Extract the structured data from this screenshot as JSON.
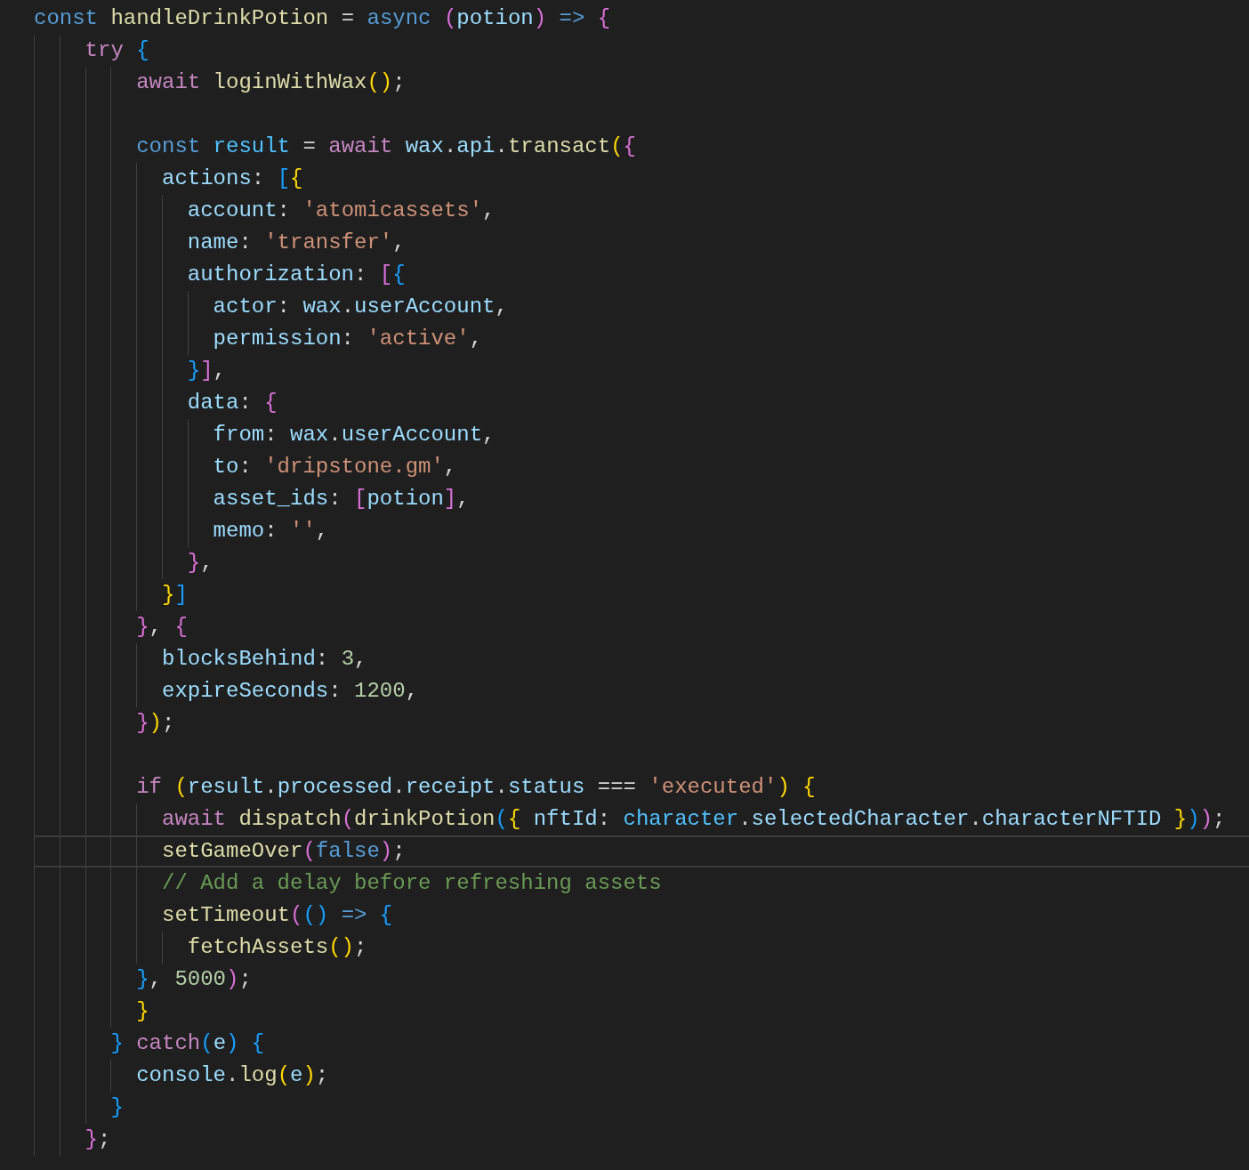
{
  "editor": {
    "lines": [
      {
        "current": false,
        "tokens": [
          {
            "text": "const ",
            "kind": "kw"
          },
          {
            "text": "handleDrinkPotion",
            "kind": "fn"
          },
          {
            "text": " = ",
            "kind": "p"
          },
          {
            "text": "async ",
            "kind": "kw"
          },
          {
            "text": "(",
            "kind": "b2"
          },
          {
            "text": "potion",
            "kind": "var"
          },
          {
            "text": ") ",
            "kind": "b2"
          },
          {
            "text": "=> ",
            "kind": "kw"
          },
          {
            "text": "{",
            "kind": "b2"
          }
        ]
      },
      {
        "current": false,
        "tokens": [
          {
            "text": "    try ",
            "kind": "ctl"
          },
          {
            "text": "{",
            "kind": "b3"
          }
        ]
      },
      {
        "current": false,
        "tokens": [
          {
            "text": "        await ",
            "kind": "ctl"
          },
          {
            "text": "loginWithWax",
            "kind": "fn"
          },
          {
            "text": "()",
            "kind": "b1"
          },
          {
            "text": ";",
            "kind": "p"
          }
        ]
      },
      {
        "current": false
      },
      {
        "current": false,
        "tokens": [
          {
            "text": "        const ",
            "kind": "kw"
          },
          {
            "text": "result",
            "kind": "const"
          },
          {
            "text": " = ",
            "kind": "p"
          },
          {
            "text": "await ",
            "kind": "ctl"
          },
          {
            "text": "wax",
            "kind": "var"
          },
          {
            "text": ".",
            "kind": "p"
          },
          {
            "text": "api",
            "kind": "var"
          },
          {
            "text": ".",
            "kind": "p"
          },
          {
            "text": "transact",
            "kind": "fn"
          },
          {
            "text": "(",
            "kind": "b1"
          },
          {
            "text": "{",
            "kind": "b2"
          }
        ]
      },
      {
        "current": false,
        "tokens": [
          {
            "text": "          actions",
            "kind": "var"
          },
          {
            "text": ": ",
            "kind": "p"
          },
          {
            "text": "[",
            "kind": "b3"
          },
          {
            "text": "{",
            "kind": "b1"
          }
        ]
      },
      {
        "current": false,
        "tokens": [
          {
            "text": "            account",
            "kind": "var"
          },
          {
            "text": ": ",
            "kind": "p"
          },
          {
            "text": "'atomicassets'",
            "kind": "str"
          },
          {
            "text": ",",
            "kind": "p"
          }
        ]
      },
      {
        "current": false,
        "tokens": [
          {
            "text": "            name",
            "kind": "var"
          },
          {
            "text": ": ",
            "kind": "p"
          },
          {
            "text": "'transfer'",
            "kind": "str"
          },
          {
            "text": ",",
            "kind": "p"
          }
        ]
      },
      {
        "current": false,
        "tokens": [
          {
            "text": "            authorization",
            "kind": "var"
          },
          {
            "text": ": ",
            "kind": "p"
          },
          {
            "text": "[",
            "kind": "b2"
          },
          {
            "text": "{",
            "kind": "b3"
          }
        ]
      },
      {
        "current": false,
        "tokens": [
          {
            "text": "              actor",
            "kind": "var"
          },
          {
            "text": ": ",
            "kind": "p"
          },
          {
            "text": "wax",
            "kind": "var"
          },
          {
            "text": ".",
            "kind": "p"
          },
          {
            "text": "userAccount",
            "kind": "var"
          },
          {
            "text": ",",
            "kind": "p"
          }
        ]
      },
      {
        "current": false,
        "tokens": [
          {
            "text": "              permission",
            "kind": "var"
          },
          {
            "text": ": ",
            "kind": "p"
          },
          {
            "text": "'active'",
            "kind": "str"
          },
          {
            "text": ",",
            "kind": "p"
          }
        ]
      },
      {
        "current": false,
        "tokens": [
          {
            "text": "            }",
            "kind": "b3"
          },
          {
            "text": "]",
            "kind": "b2"
          },
          {
            "text": ",",
            "kind": "p"
          }
        ]
      },
      {
        "current": false,
        "tokens": [
          {
            "text": "            data",
            "kind": "var"
          },
          {
            "text": ": ",
            "kind": "p"
          },
          {
            "text": "{",
            "kind": "b2"
          }
        ]
      },
      {
        "current": false,
        "tokens": [
          {
            "text": "              from",
            "kind": "var"
          },
          {
            "text": ": ",
            "kind": "p"
          },
          {
            "text": "wax",
            "kind": "var"
          },
          {
            "text": ".",
            "kind": "p"
          },
          {
            "text": "userAccount",
            "kind": "var"
          },
          {
            "text": ",",
            "kind": "p"
          }
        ]
      },
      {
        "current": false,
        "tokens": [
          {
            "text": "              to",
            "kind": "var"
          },
          {
            "text": ": ",
            "kind": "p"
          },
          {
            "text": "'dripstone.gm'",
            "kind": "str"
          },
          {
            "text": ",",
            "kind": "p"
          }
        ]
      },
      {
        "current": false,
        "tokens": [
          {
            "text": "              asset_ids",
            "kind": "var"
          },
          {
            "text": ": ",
            "kind": "p"
          },
          {
            "text": "[",
            "kind": "b2"
          },
          {
            "text": "potion",
            "kind": "var"
          },
          {
            "text": "]",
            "kind": "b2"
          },
          {
            "text": ",",
            "kind": "p"
          }
        ]
      },
      {
        "current": false,
        "tokens": [
          {
            "text": "              memo",
            "kind": "var"
          },
          {
            "text": ": ",
            "kind": "p"
          },
          {
            "text": "''",
            "kind": "str"
          },
          {
            "text": ",",
            "kind": "p"
          }
        ]
      },
      {
        "current": false,
        "tokens": [
          {
            "text": "            }",
            "kind": "b2"
          },
          {
            "text": ",",
            "kind": "p"
          }
        ]
      },
      {
        "current": false,
        "tokens": [
          {
            "text": "          }",
            "kind": "b1"
          },
          {
            "text": "]",
            "kind": "b3"
          }
        ]
      },
      {
        "current": false,
        "tokens": [
          {
            "text": "        }",
            "kind": "b2"
          },
          {
            "text": ", ",
            "kind": "p"
          },
          {
            "text": "{",
            "kind": "b2"
          }
        ]
      },
      {
        "current": false,
        "tokens": [
          {
            "text": "          blocksBehind",
            "kind": "var"
          },
          {
            "text": ": ",
            "kind": "p"
          },
          {
            "text": "3",
            "kind": "num"
          },
          {
            "text": ",",
            "kind": "p"
          }
        ]
      },
      {
        "current": false,
        "tokens": [
          {
            "text": "          expireSeconds",
            "kind": "var"
          },
          {
            "text": ": ",
            "kind": "p"
          },
          {
            "text": "1200",
            "kind": "num"
          },
          {
            "text": ",",
            "kind": "p"
          }
        ]
      },
      {
        "current": false,
        "tokens": [
          {
            "text": "        }",
            "kind": "b2"
          },
          {
            "text": ")",
            "kind": "b1"
          },
          {
            "text": ";",
            "kind": "p"
          }
        ]
      },
      {
        "current": false
      },
      {
        "current": false,
        "tokens": [
          {
            "text": "        if ",
            "kind": "ctl"
          },
          {
            "text": "(",
            "kind": "b1"
          },
          {
            "text": "result",
            "kind": "var"
          },
          {
            "text": ".",
            "kind": "p"
          },
          {
            "text": "processed",
            "kind": "var"
          },
          {
            "text": ".",
            "kind": "p"
          },
          {
            "text": "receipt",
            "kind": "var"
          },
          {
            "text": ".",
            "kind": "p"
          },
          {
            "text": "status",
            "kind": "var"
          },
          {
            "text": " === ",
            "kind": "p"
          },
          {
            "text": "'executed'",
            "kind": "str"
          },
          {
            "text": ") ",
            "kind": "b1"
          },
          {
            "text": "{",
            "kind": "b1"
          }
        ]
      },
      {
        "current": false,
        "tokens": [
          {
            "text": "          await ",
            "kind": "ctl"
          },
          {
            "text": "dispatch",
            "kind": "fn"
          },
          {
            "text": "(",
            "kind": "b2"
          },
          {
            "text": "drinkPotion",
            "kind": "fn"
          },
          {
            "text": "(",
            "kind": "b3"
          },
          {
            "text": "{ ",
            "kind": "b1"
          },
          {
            "text": "nftId",
            "kind": "var"
          },
          {
            "text": ": ",
            "kind": "p"
          },
          {
            "text": "character",
            "kind": "const"
          },
          {
            "text": ".",
            "kind": "p"
          },
          {
            "text": "selectedCharacter",
            "kind": "var"
          },
          {
            "text": ".",
            "kind": "p"
          },
          {
            "text": "characterNFTID ",
            "kind": "var"
          },
          {
            "text": "}",
            "kind": "b1"
          },
          {
            "text": ")",
            "kind": "b3"
          },
          {
            "text": ")",
            "kind": "b2"
          },
          {
            "text": ";",
            "kind": "p"
          }
        ]
      },
      {
        "current": true,
        "tokens": [
          {
            "text": "          setGameOver",
            "kind": "fn"
          },
          {
            "text": "(",
            "kind": "b2"
          },
          {
            "text": "false",
            "kind": "kw"
          },
          {
            "text": ")",
            "kind": "b2"
          },
          {
            "text": ";",
            "kind": "p"
          }
        ]
      },
      {
        "current": false,
        "tokens": [
          {
            "text": "          // Add a delay before refreshing assets",
            "kind": "cmt"
          }
        ]
      },
      {
        "current": false,
        "tokens": [
          {
            "text": "          setTimeout",
            "kind": "fn"
          },
          {
            "text": "(",
            "kind": "b2"
          },
          {
            "text": "() ",
            "kind": "b3"
          },
          {
            "text": "=> ",
            "kind": "kw"
          },
          {
            "text": "{",
            "kind": "b3"
          }
        ]
      },
      {
        "current": false,
        "tokens": [
          {
            "text": "            fetchAssets",
            "kind": "fn"
          },
          {
            "text": "()",
            "kind": "b1"
          },
          {
            "text": ";",
            "kind": "p"
          }
        ]
      },
      {
        "current": false,
        "tokens": [
          {
            "text": "        }",
            "kind": "b3"
          },
          {
            "text": ", ",
            "kind": "p"
          },
          {
            "text": "5000",
            "kind": "num"
          },
          {
            "text": ")",
            "kind": "b2"
          },
          {
            "text": ";",
            "kind": "p"
          }
        ]
      },
      {
        "current": false,
        "tokens": [
          {
            "text": "        }",
            "kind": "b1"
          }
        ]
      },
      {
        "current": false,
        "tokens": [
          {
            "text": "      } ",
            "kind": "b3"
          },
          {
            "text": "catch",
            "kind": "ctl"
          },
          {
            "text": "(",
            "kind": "b3"
          },
          {
            "text": "e",
            "kind": "var"
          },
          {
            "text": ") ",
            "kind": "b3"
          },
          {
            "text": "{",
            "kind": "b3"
          }
        ]
      },
      {
        "current": false,
        "tokens": [
          {
            "text": "        console",
            "kind": "var"
          },
          {
            "text": ".",
            "kind": "p"
          },
          {
            "text": "log",
            "kind": "fn"
          },
          {
            "text": "(",
            "kind": "b1"
          },
          {
            "text": "e",
            "kind": "var"
          },
          {
            "text": ")",
            "kind": "b1"
          },
          {
            "text": ";",
            "kind": "p"
          }
        ]
      },
      {
        "current": false,
        "tokens": [
          {
            "text": "      }",
            "kind": "b3"
          }
        ]
      },
      {
        "current": false,
        "tokens": [
          {
            "text": "    }",
            "kind": "b2"
          },
          {
            "text": ";",
            "kind": "p"
          }
        ]
      }
    ]
  }
}
